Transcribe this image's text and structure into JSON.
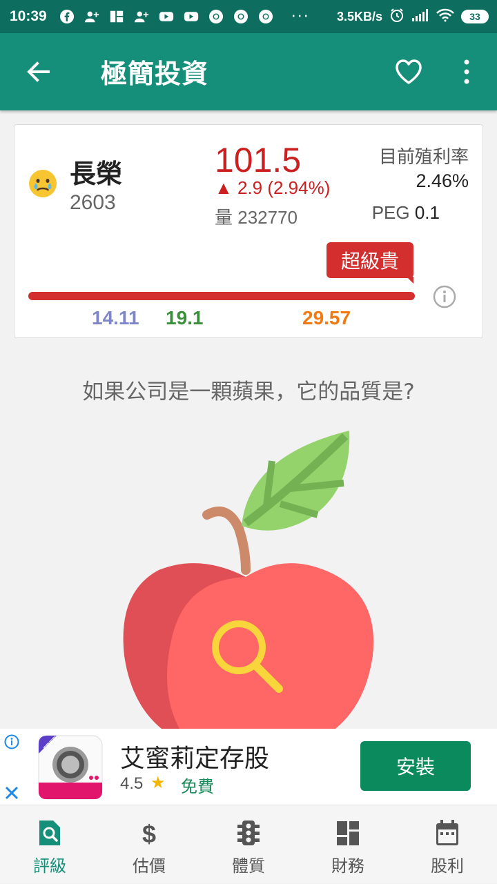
{
  "status_bar": {
    "time": "10:39",
    "icons": [
      "facebook-icon",
      "person-add-icon",
      "app-icon",
      "person-add-icon",
      "youtube-icon",
      "youtube-icon",
      "chrome-icon",
      "chrome-icon",
      "chrome-icon"
    ],
    "more_dots": "···",
    "speed": "3.5KB/s",
    "battery": "33"
  },
  "appbar": {
    "title": "極簡投資",
    "accent_color": "#168f7a"
  },
  "stock": {
    "name": "長榮",
    "code": "2603",
    "price": "101.5",
    "change": "▲ 2.9 (2.94%)",
    "volume_label": "量",
    "volume": "232770",
    "yield_label": "目前殖利率",
    "yield_value": "2.46%",
    "peg_label": "PEG",
    "peg_value": "0.1",
    "valuation_badge": "超級貴",
    "price_levels": [
      "14.11",
      "19.1",
      "29.57"
    ],
    "colors": {
      "up": "#cc1f1f",
      "cheap": "#7e86c7",
      "fair": "#3a8f3a",
      "expensive": "#ef7a13"
    }
  },
  "quality": {
    "question": "如果公司是一顆蘋果，它的品質是?"
  },
  "ad": {
    "app_badge": "FREE",
    "title": "艾蜜莉定存股",
    "rating": "4.5",
    "price": "免費",
    "install_label": "安裝"
  },
  "bottom_nav": [
    {
      "label": "評級",
      "icon": "search-doc-icon",
      "active": true
    },
    {
      "label": "估價",
      "icon": "dollar-icon",
      "active": false
    },
    {
      "label": "體質",
      "icon": "traffic-light-icon",
      "active": false
    },
    {
      "label": "財務",
      "icon": "dashboard-icon",
      "active": false
    },
    {
      "label": "股利",
      "icon": "calendar-icon",
      "active": false
    }
  ]
}
